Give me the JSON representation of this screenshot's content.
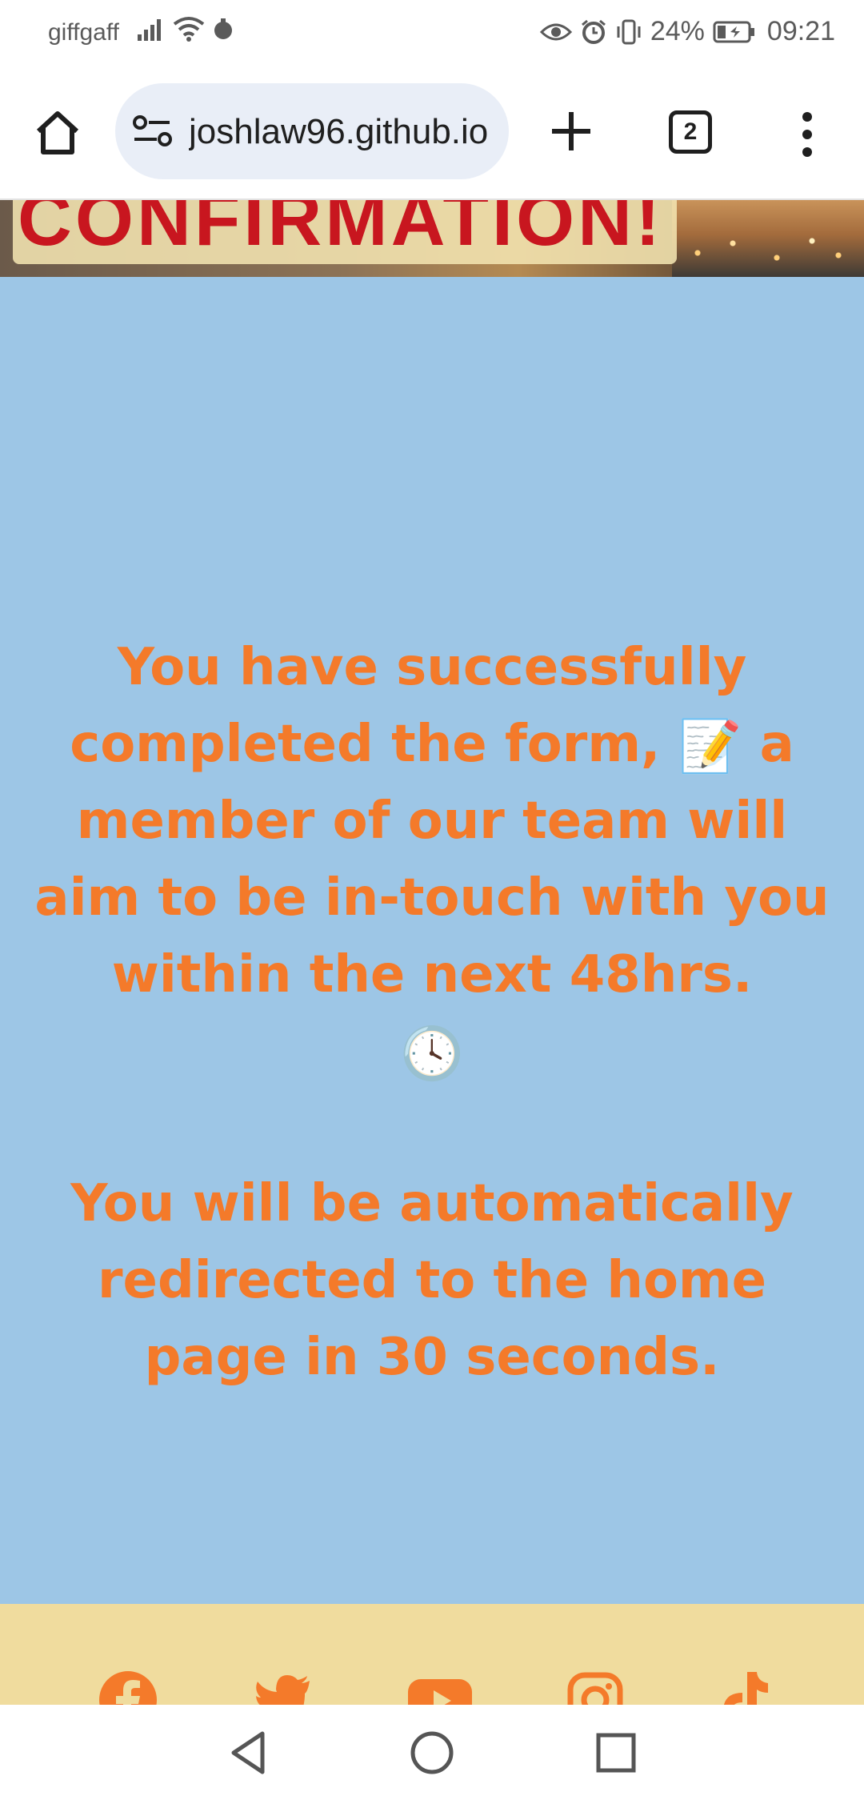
{
  "status_bar": {
    "carrier": "giffgaff",
    "battery": "24%",
    "time": "09:21",
    "icons": [
      "signal-icon",
      "wifi-icon",
      "notification-icon",
      "eye-icon",
      "alarm-icon",
      "vibrate-icon",
      "battery-icon"
    ]
  },
  "browser": {
    "url": "joshlaw96.github.io",
    "tab_count": "2",
    "icons": [
      "home-icon",
      "site-settings-icon",
      "new-tab-icon",
      "tab-switcher-icon",
      "overflow-menu-icon"
    ]
  },
  "hero": {
    "title": "CONFIRMATION!"
  },
  "main": {
    "message": "You have successfully completed the form,",
    "message_emoji": "📝",
    "message_cont": "a member of our team will aim to be in-touch with you within the next 48hrs.",
    "clock_emoji": "🕓",
    "redirect": "You will be automatically redirected to the home page in 30 seconds."
  },
  "footer": {
    "social_icons": [
      "facebook-icon",
      "twitter-icon",
      "youtube-icon",
      "instagram-icon",
      "tiktok-icon"
    ],
    "accent": "#f47a2a"
  },
  "colors": {
    "page_bg": "#9dc6e6",
    "text_orange": "#f47a2a",
    "title_red": "#c8161f",
    "footer_bg": "#f0dc9e"
  }
}
